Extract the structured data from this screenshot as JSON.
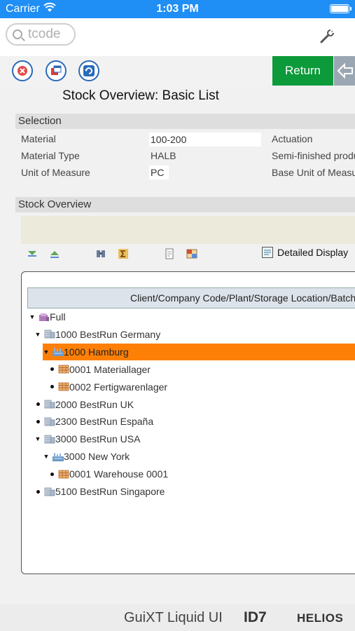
{
  "status_bar": {
    "carrier": "Carrier",
    "time": "1:03 PM"
  },
  "tcode": {
    "placeholder": "tcode",
    "icon": "search-icon"
  },
  "toolbar": {
    "return_label": "Return"
  },
  "page": {
    "title": "Stock Overview: Basic List"
  },
  "selection": {
    "header": "Selection",
    "material_label": "Material",
    "material_value": "100-200",
    "material_desc": "Actuation",
    "material_type_label": "Material Type",
    "material_type_value": "HALB",
    "material_type_desc": "Semi-finished product",
    "uom_label": "Unit of Measure",
    "uom_value": "PC",
    "uom_desc": "Base Unit of Measure"
  },
  "stock_overview": {
    "header": "Stock Overview",
    "detailed_display": "Detailed Display",
    "tree_header": "Client/Company Code/Plant/Storage Location/Batch/Special Stock",
    "nodes": [
      {
        "label": "Full",
        "level": 0,
        "type": "client",
        "expanded": true
      },
      {
        "label": "1000 BestRun Germany",
        "level": 1,
        "type": "company",
        "expanded": true
      },
      {
        "label": "1000 Hamburg",
        "level": 2,
        "type": "plant",
        "expanded": true,
        "selected": true
      },
      {
        "label": "0001 Materiallager",
        "level": 3,
        "type": "storage"
      },
      {
        "label": "0002 Fertigwarenlager",
        "level": 3,
        "type": "storage"
      },
      {
        "label": "2000 BestRun UK",
        "level": 1,
        "type": "company"
      },
      {
        "label": "2300 BestRun España",
        "level": 1,
        "type": "company"
      },
      {
        "label": "3000 BestRun USA",
        "level": 1,
        "type": "company",
        "expanded": true
      },
      {
        "label": "3000 New York",
        "level": 2,
        "type": "plant",
        "expanded": true
      },
      {
        "label": "0001 Warehouse 0001",
        "level": 3,
        "type": "storage"
      },
      {
        "label": "5100 BestRun Singapore",
        "level": 1,
        "type": "company"
      }
    ]
  },
  "footer": {
    "brand": "GuiXT Liquid UI",
    "id7": "ID7",
    "helios": "HELIOS"
  },
  "colors": {
    "status_bar": "#1f8ef5",
    "return_button": "#0c9a3a",
    "selected_node": "#fe7f06"
  }
}
